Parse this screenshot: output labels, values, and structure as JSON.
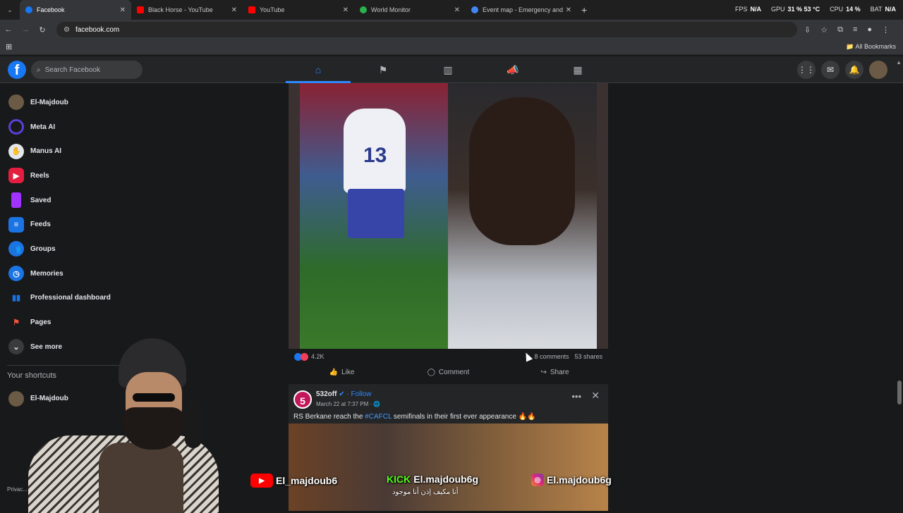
{
  "browser": {
    "tabs": [
      {
        "title": "Facebook",
        "color": "#1877f2",
        "active": true
      },
      {
        "title": "Black Horse - YouTube",
        "color": "#ff0000",
        "active": false
      },
      {
        "title": "YouTube",
        "color": "#ff0000",
        "active": false
      },
      {
        "title": "World Monitor",
        "color": "#2bb24c",
        "active": false
      },
      {
        "title": "Event map - Emergency and Di...",
        "color": "#4285f4",
        "active": false
      }
    ],
    "url": "facebook.com",
    "all_bookmarks": "All Bookmarks",
    "sys": {
      "fps_label": "FPS",
      "fps": "N/A",
      "gpu_label": "GPU",
      "gpu": "31 % 53 °C",
      "cpu_label": "CPU",
      "cpu": "14 %",
      "bat_label": "BAT",
      "bat": "N/A"
    }
  },
  "facebook": {
    "search_placeholder": "Search Facebook",
    "sidebar": [
      {
        "label": "El-Majdoub",
        "icon": "avatar",
        "color": "#6b5a45"
      },
      {
        "label": "Meta AI",
        "icon": "meta-ai-icon",
        "color": "#5b3fd9"
      },
      {
        "label": "Manus AI",
        "icon": "manus-ai-icon",
        "color": "#e4e6eb"
      },
      {
        "label": "Reels",
        "icon": "reels-icon",
        "color": "#e41e3f"
      },
      {
        "label": "Saved",
        "icon": "saved-icon",
        "color": "#a033ff"
      },
      {
        "label": "Feeds",
        "icon": "feeds-icon",
        "color": "#1b74e4"
      },
      {
        "label": "Groups",
        "icon": "groups-icon",
        "color": "#1b74e4"
      },
      {
        "label": "Memories",
        "icon": "memories-icon",
        "color": "#1b74e4"
      },
      {
        "label": "Professional dashboard",
        "icon": "dashboard-icon",
        "color": "#1b74e4"
      },
      {
        "label": "Pages",
        "icon": "pages-icon",
        "color": "#f7533e"
      },
      {
        "label": "See more",
        "icon": "chevron-down-icon",
        "color": "#3a3b3c"
      }
    ],
    "shortcuts_title": "Your shortcuts",
    "shortcuts": [
      {
        "label": "El-Majdoub"
      }
    ],
    "privacy": "Privac...",
    "post1": {
      "reactions_count": "4.2K",
      "comments": "8 comments",
      "shares": "53 shares",
      "like": "Like",
      "comment": "Comment",
      "share": "Share",
      "jersey_number": "13"
    },
    "post2": {
      "avatar_text": "5",
      "page_name": "532off",
      "follow": "Follow",
      "date": "March 22 at 7:37 PM",
      "text_before": "RS Berkane reach the ",
      "hashtag": "#CAFCL",
      "text_after": " semifinals in their first ever appearance 🔥🔥"
    }
  },
  "overlay": {
    "youtube_handle": "El_majdoub6",
    "kick_label": "KICK",
    "kick_handle": "El.majdoub6g",
    "instagram_handle": "El.majdoub6g",
    "arabic_caption": "أنا مكيف إذن أنا موجود"
  }
}
